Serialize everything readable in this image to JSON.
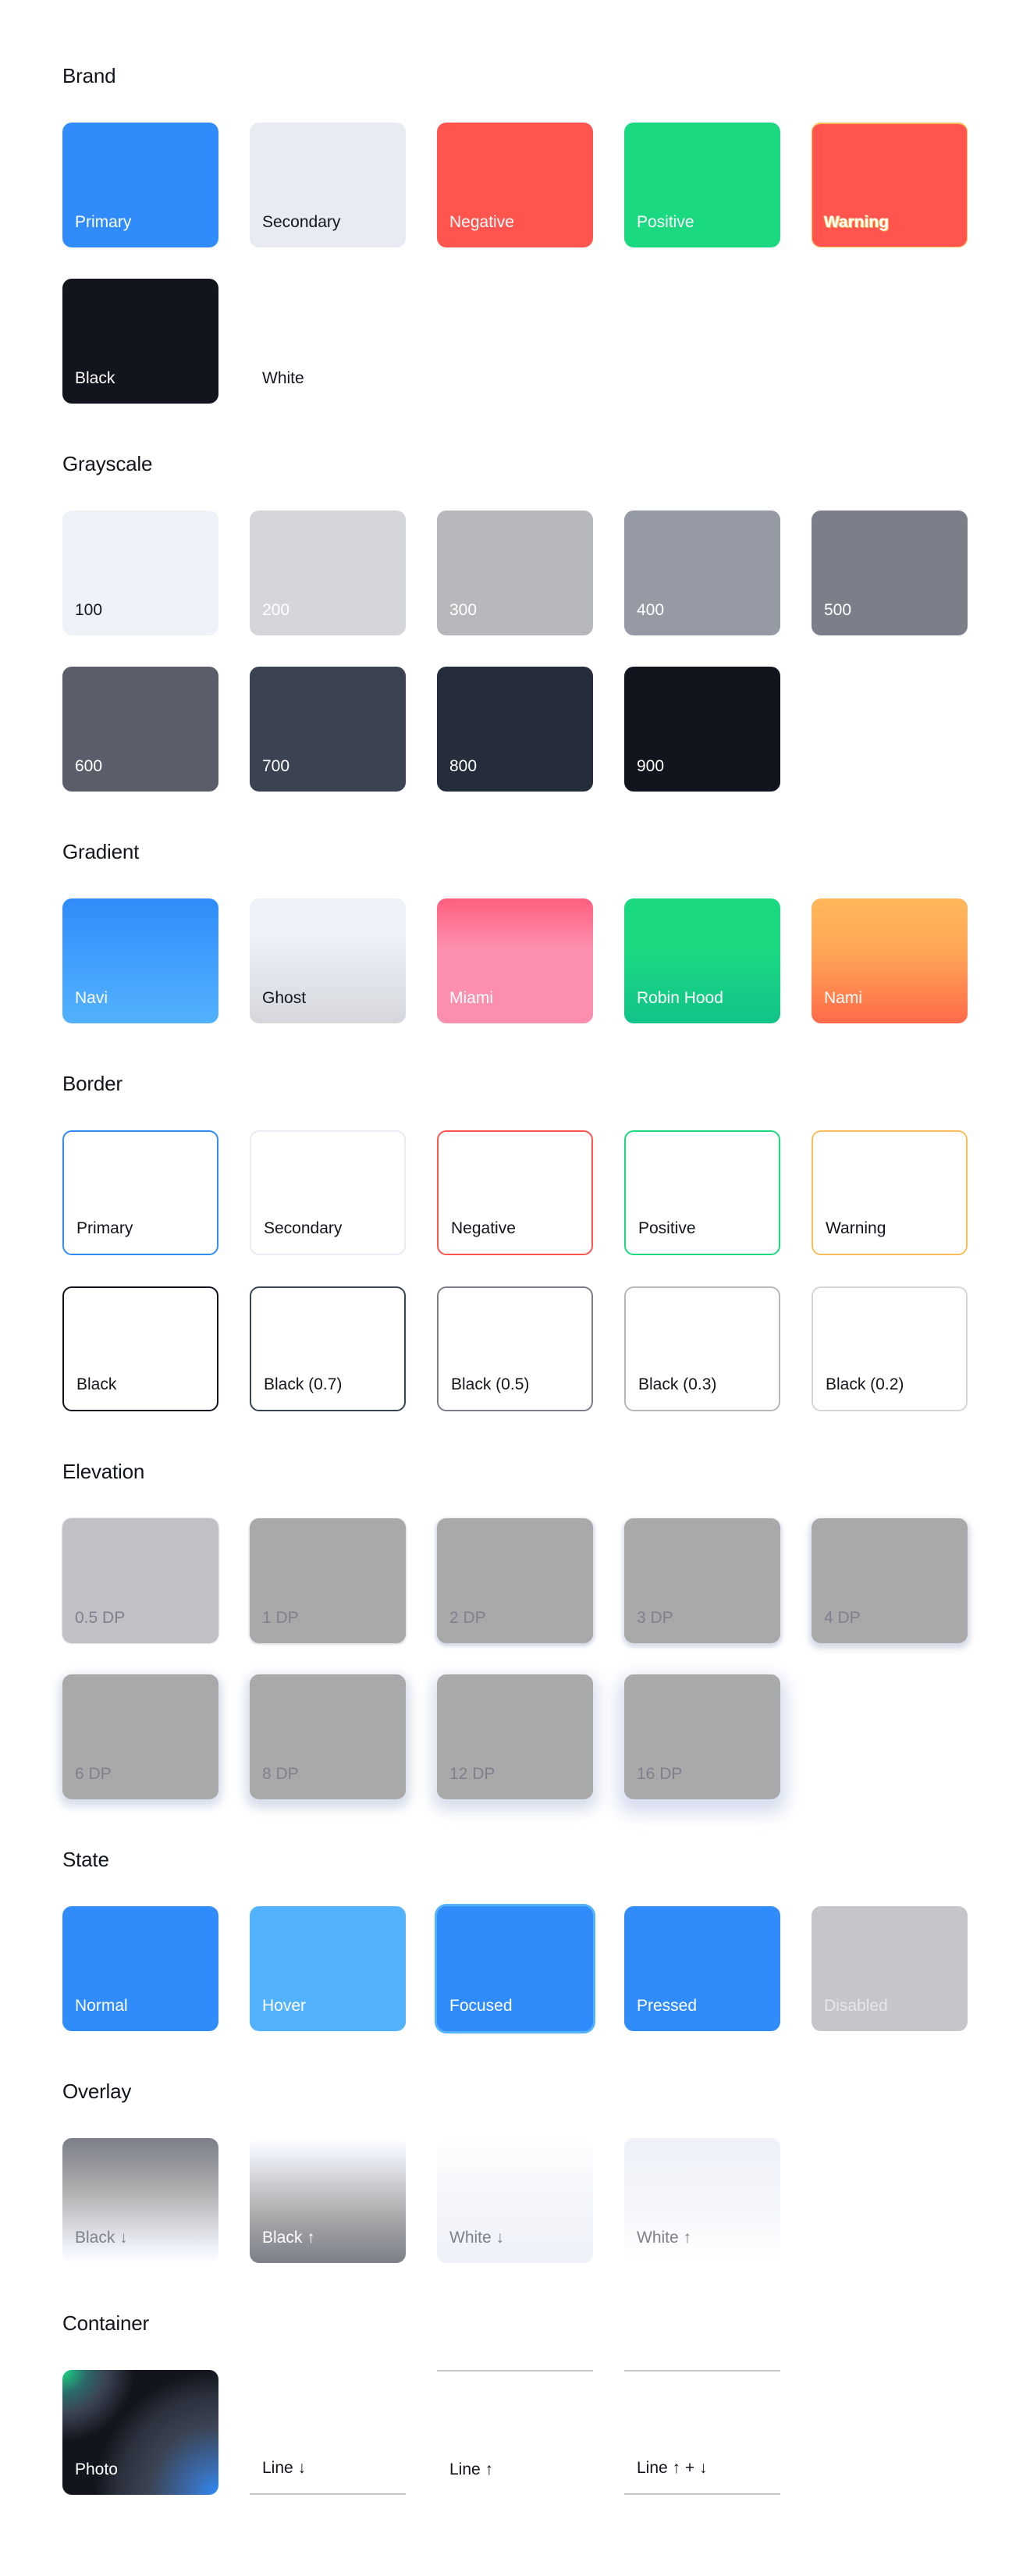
{
  "sections": [
    {
      "title": "Brand",
      "tiles": [
        {
          "label": "Primary",
          "color": "#2f8cfa"
        },
        {
          "label": "Secondary",
          "color": "#e8ebf3"
        },
        {
          "label": "Negative",
          "color": "#ff554e"
        },
        {
          "label": "Positive",
          "color": "#1bd981"
        },
        {
          "label": "Warning",
          "color": "#ff554e",
          "accent": "#ffbd5a"
        },
        {
          "label": "Black",
          "color": "#12151d"
        },
        {
          "label": "White",
          "color": "#ffffff"
        }
      ]
    },
    {
      "title": "Grayscale",
      "tiles": [
        {
          "label": "100",
          "color": "#eff2f8"
        },
        {
          "label": "200",
          "color": "#d5d6da"
        },
        {
          "label": "300",
          "color": "#b7b8bb"
        },
        {
          "label": "400",
          "color": "#959aa5"
        },
        {
          "label": "500",
          "color": "#7c7f89"
        },
        {
          "label": "600",
          "color": "#5b5e6a"
        },
        {
          "label": "700",
          "color": "#3b4352"
        },
        {
          "label": "800",
          "color": "#262d3a"
        },
        {
          "label": "900",
          "color": "#12151d"
        }
      ]
    },
    {
      "title": "Gradient",
      "tiles": [
        {
          "label": "Navi",
          "from": "#2f8cfa",
          "to": "#52b2fe"
        },
        {
          "label": "Ghost",
          "from": "#eef1f8",
          "to": "#d5d7dc"
        },
        {
          "label": "Miami",
          "from": "#ff5f7e",
          "to": "#fd8fae"
        },
        {
          "label": "Robin Hood",
          "from": "#1bd981",
          "to": "#12c38a"
        },
        {
          "label": "Nami",
          "from": "#ffb85a",
          "to": "#ff6a4a"
        }
      ]
    },
    {
      "title": "Border",
      "tiles": [
        {
          "label": "Primary",
          "border": "#2f8cfa"
        },
        {
          "label": "Secondary",
          "border": "#e8ebf3"
        },
        {
          "label": "Negative",
          "border": "#ff554e"
        },
        {
          "label": "Positive",
          "border": "#1bd981"
        },
        {
          "label": "Warning",
          "border": "#ffbd5a"
        },
        {
          "label": "Black",
          "border": "#12151d"
        },
        {
          "label": "Black (0.7)",
          "border": "#3b4352"
        },
        {
          "label": "Black (0.5)",
          "border": "#7c7f89"
        },
        {
          "label": "Black (0.3)",
          "border": "#b7b8bb"
        },
        {
          "label": "Black (0.2)",
          "border": "#d5d6da"
        }
      ]
    },
    {
      "title": "Elevation",
      "tiles": [
        {
          "label": "0.5 DP",
          "dp": 0.5
        },
        {
          "label": "1 DP",
          "dp": 1
        },
        {
          "label": "2 DP",
          "dp": 2
        },
        {
          "label": "3 DP",
          "dp": 3
        },
        {
          "label": "4 DP",
          "dp": 4
        },
        {
          "label": "6 DP",
          "dp": 6
        },
        {
          "label": "8 DP",
          "dp": 8
        },
        {
          "label": "12 DP",
          "dp": 12
        },
        {
          "label": "16 DP",
          "dp": 16
        }
      ]
    },
    {
      "title": "State",
      "tiles": [
        {
          "label": "Normal",
          "color": "#2f8cfa"
        },
        {
          "label": "Hover",
          "color": "#52b2fe"
        },
        {
          "label": "Focused",
          "color": "#2f8cfa",
          "ring": "#52b2fe"
        },
        {
          "label": "Pressed",
          "color": "#2f8cfa"
        },
        {
          "label": "Disabled",
          "color": "#c6c6ca"
        }
      ]
    },
    {
      "title": "Overlay",
      "tiles": [
        {
          "label": "Black ↓"
        },
        {
          "label": "Black ↑"
        },
        {
          "label": "White ↓"
        },
        {
          "label": "White ↑"
        }
      ]
    },
    {
      "title": "Container",
      "tiles": [
        {
          "label": "Photo"
        },
        {
          "label": "Line ↓"
        },
        {
          "label": "Line ↑"
        },
        {
          "label": "Line ↑ + ↓"
        }
      ]
    }
  ]
}
